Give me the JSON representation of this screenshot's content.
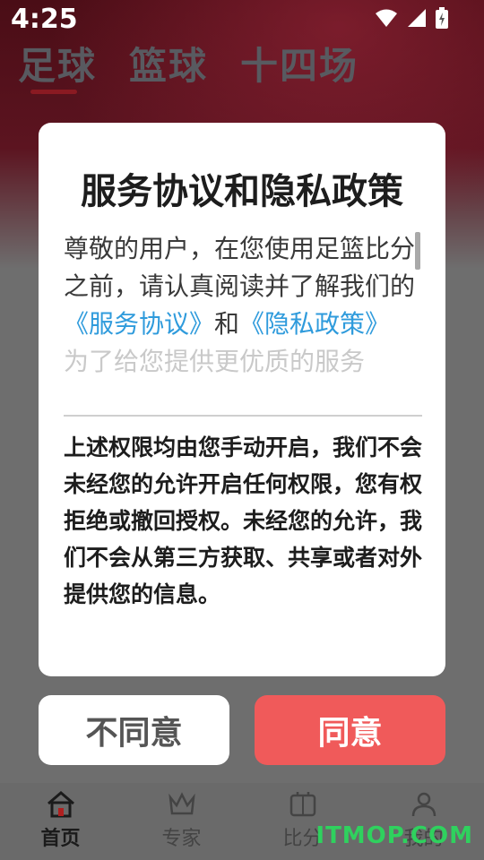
{
  "status_bar": {
    "time": "4:25"
  },
  "sports_tabs": [
    {
      "label": "足球",
      "active": true
    },
    {
      "label": "篮球",
      "active": false
    },
    {
      "label": "十四场",
      "active": false
    }
  ],
  "dialog": {
    "title": "服务协议和隐私政策",
    "intro_1": "尊敬的用户，在您使用足篮比分之前，请认真阅读并了解我们的",
    "link_service": "《服务协议》",
    "and": "和",
    "link_privacy": "《隐私政策》",
    "fade_text": "为了给您提供更优质的服务",
    "notice": "上述权限均由您手动开启，我们不会未经您的允许开启任何权限，您有权拒绝或撤回授权。未经您的允许，我们不会从第三方获取、共享或者对外提供您的信息。",
    "disagree_label": "不同意",
    "agree_label": "同意"
  },
  "bottom_nav": [
    {
      "label": "首页",
      "icon": "home-icon",
      "active": true
    },
    {
      "label": "专家",
      "icon": "crown-icon",
      "active": false
    },
    {
      "label": "比分",
      "icon": "scoreboard-icon",
      "active": false
    },
    {
      "label": "我的",
      "icon": "user-icon",
      "active": false
    }
  ],
  "watermark": "ITMOP.COM",
  "colors": {
    "accent": "#f05a5a",
    "link": "#2f9bdc",
    "header": "#5c1420"
  }
}
